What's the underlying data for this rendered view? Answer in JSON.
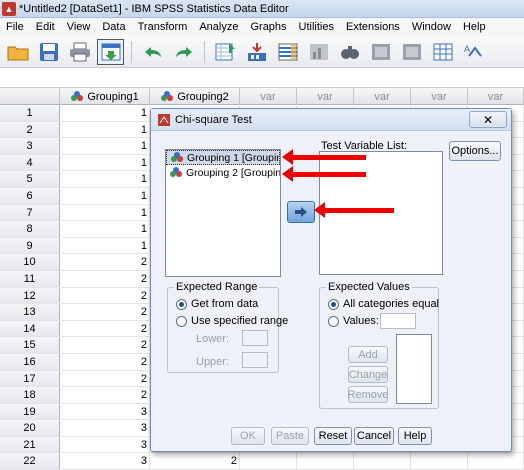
{
  "window": {
    "title": "*Untitled2 [DataSet1] - IBM SPSS Statistics Data Editor"
  },
  "menu": [
    {
      "label": "File"
    },
    {
      "label": "Edit"
    },
    {
      "label": "View"
    },
    {
      "label": "Data"
    },
    {
      "label": "Transform"
    },
    {
      "label": "Analyze"
    },
    {
      "label": "Graphs"
    },
    {
      "label": "Utilities"
    },
    {
      "label": "Extensions"
    },
    {
      "label": "Window"
    },
    {
      "label": "Help"
    }
  ],
  "grid": {
    "columns": [
      "Grouping1",
      "Grouping2",
      "var",
      "var",
      "var",
      "var",
      "var"
    ],
    "rows": [
      {
        "n": "1",
        "g1": "1",
        "g2": ""
      },
      {
        "n": "2",
        "g1": "1",
        "g2": ""
      },
      {
        "n": "3",
        "g1": "1",
        "g2": ""
      },
      {
        "n": "4",
        "g1": "1",
        "g2": ""
      },
      {
        "n": "5",
        "g1": "1",
        "g2": ""
      },
      {
        "n": "6",
        "g1": "1",
        "g2": ""
      },
      {
        "n": "7",
        "g1": "1",
        "g2": ""
      },
      {
        "n": "8",
        "g1": "1",
        "g2": ""
      },
      {
        "n": "9",
        "g1": "1",
        "g2": ""
      },
      {
        "n": "10",
        "g1": "2",
        "g2": ""
      },
      {
        "n": "11",
        "g1": "2",
        "g2": ""
      },
      {
        "n": "12",
        "g1": "2",
        "g2": ""
      },
      {
        "n": "13",
        "g1": "2",
        "g2": ""
      },
      {
        "n": "14",
        "g1": "2",
        "g2": ""
      },
      {
        "n": "15",
        "g1": "2",
        "g2": ""
      },
      {
        "n": "16",
        "g1": "2",
        "g2": ""
      },
      {
        "n": "17",
        "g1": "2",
        "g2": ""
      },
      {
        "n": "18",
        "g1": "2",
        "g2": ""
      },
      {
        "n": "19",
        "g1": "3",
        "g2": ""
      },
      {
        "n": "20",
        "g1": "3",
        "g2": ""
      },
      {
        "n": "21",
        "g1": "3",
        "g2": ""
      },
      {
        "n": "22",
        "g1": "3",
        "g2": "2"
      }
    ]
  },
  "dialog": {
    "title": "Chi-square Test",
    "close": "✕",
    "source_vars": [
      "Grouping 1 [Groupin...",
      "Grouping 2 [Groupin..."
    ],
    "test_list_label": "Test Variable List:",
    "options_label": "Options...",
    "expected_range": {
      "title": "Expected Range",
      "opt1": "Get from data",
      "opt2": "Use specified range",
      "lower": "Lower:",
      "upper": "Upper:"
    },
    "expected_values": {
      "title": "Expected Values",
      "opt1": "All categories equal",
      "opt2": "Values:",
      "add": "Add",
      "change": "Change",
      "remove": "Remove"
    },
    "buttons": {
      "ok": "OK",
      "paste": "Paste",
      "reset": "Reset",
      "cancel": "Cancel",
      "help": "Help"
    }
  },
  "colors": {
    "annotation_arrow": "#ee0000",
    "accent": "#3c6fa8"
  }
}
